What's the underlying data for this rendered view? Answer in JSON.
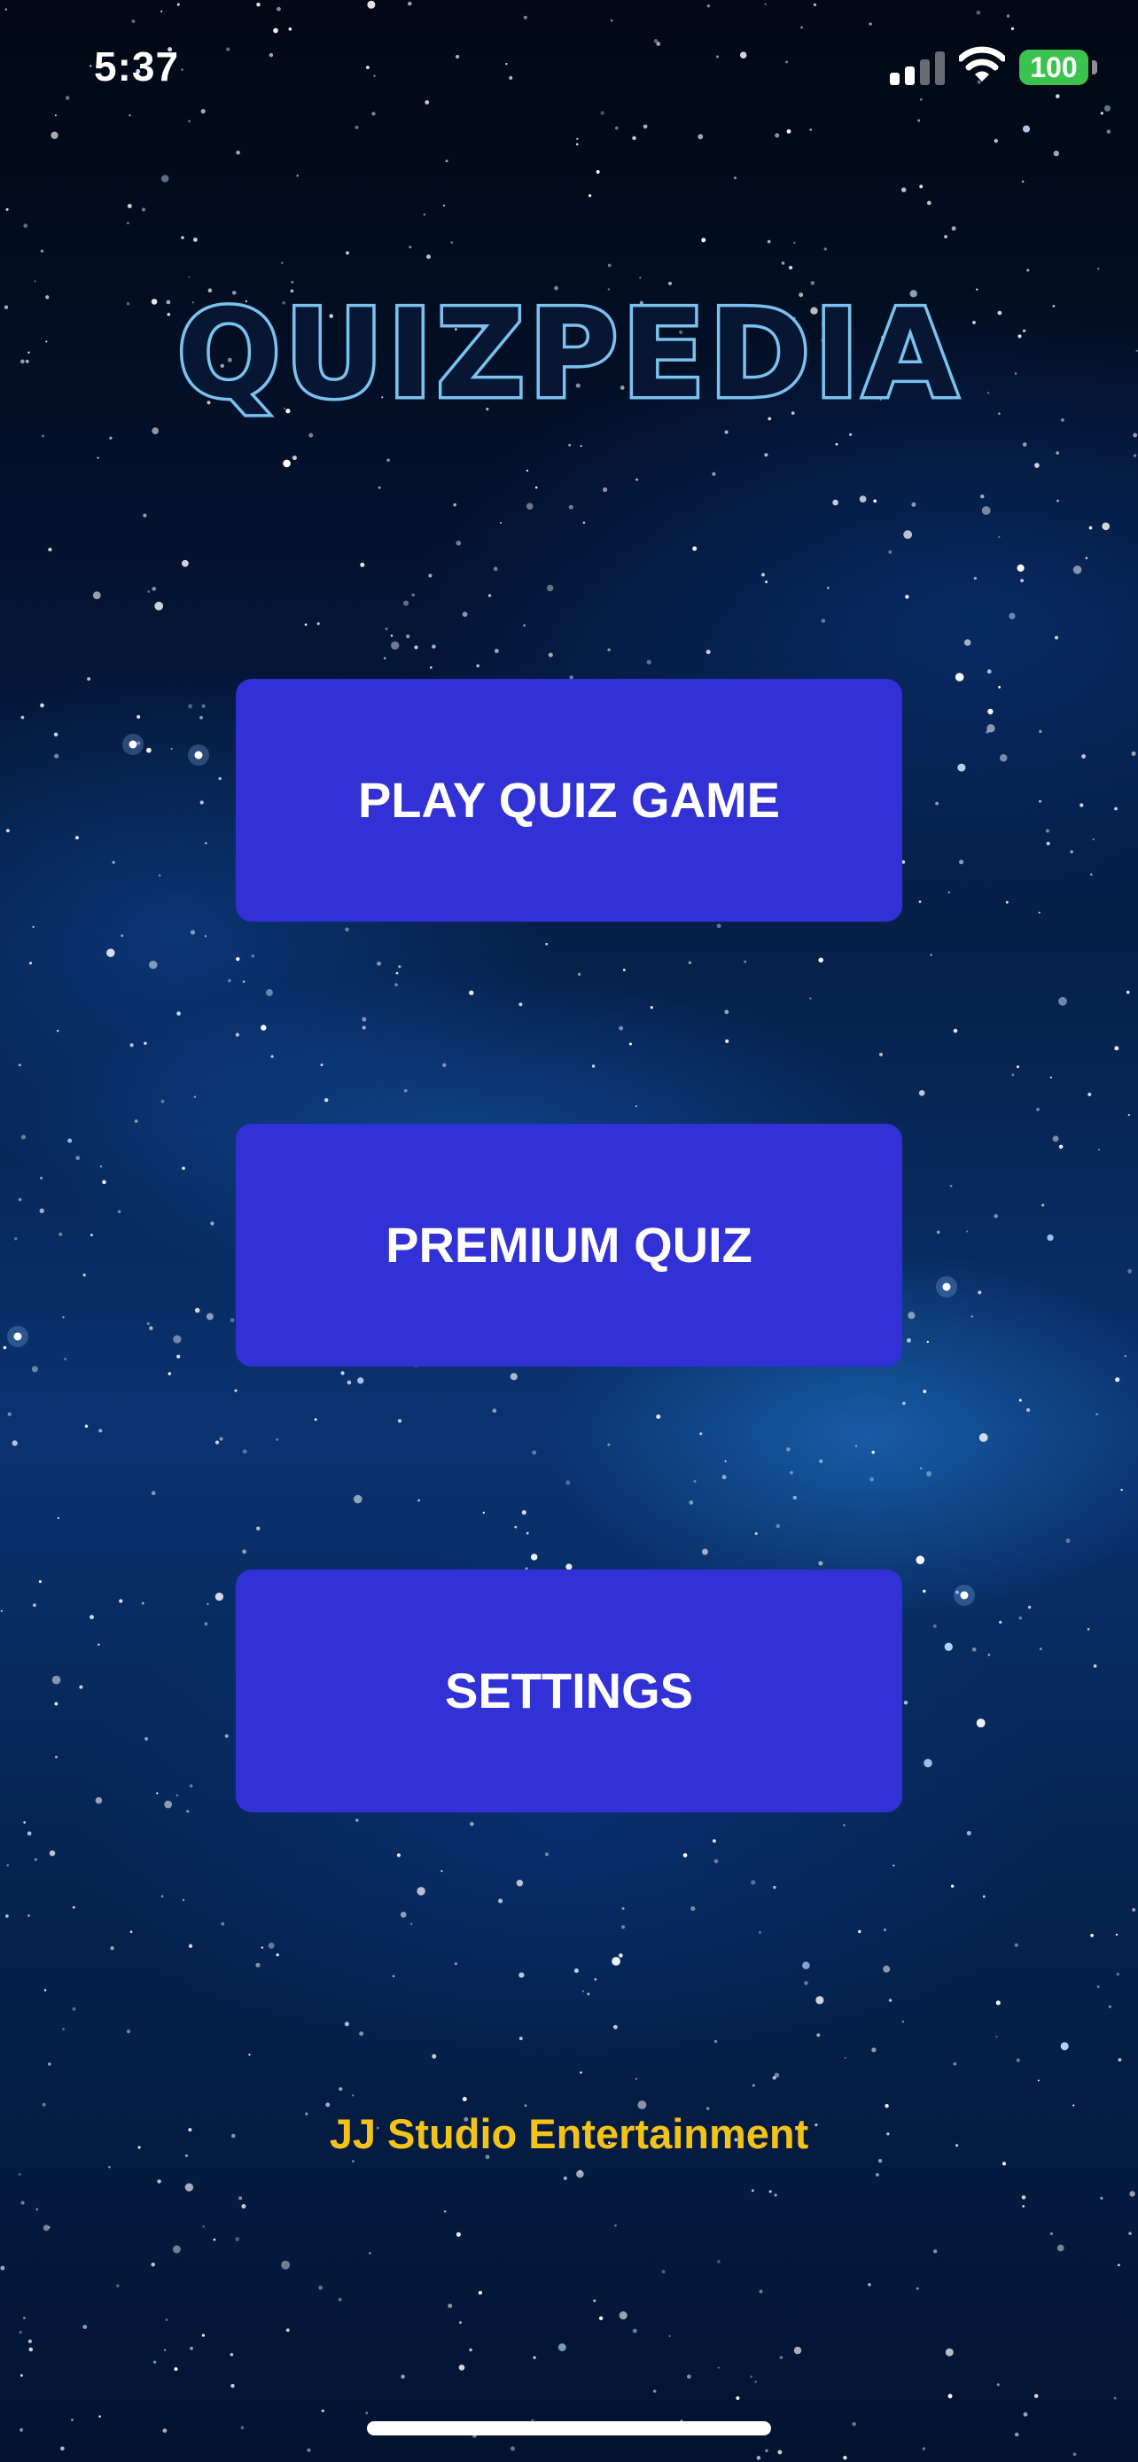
{
  "status_bar": {
    "time": "5:37",
    "battery_level": "100",
    "battery_color": "#3bc24f",
    "signal_bars_active": 2,
    "signal_bars_total": 4,
    "icons": [
      "signal-icon",
      "wifi-icon",
      "battery-icon"
    ]
  },
  "app": {
    "title": "QUIZPEDIA",
    "title_color": "#7cc2ef"
  },
  "menu": {
    "play_label": "PLAY QUIZ GAME",
    "premium_label": "PREMIUM QUIZ",
    "settings_label": "SETTINGS",
    "button_color": "#3131d6"
  },
  "footer": {
    "credit": "JJ Studio Entertainment",
    "credit_color": "#f3c317"
  },
  "theme": {
    "background": "starfield-nebula",
    "accent": "#3131d6"
  }
}
